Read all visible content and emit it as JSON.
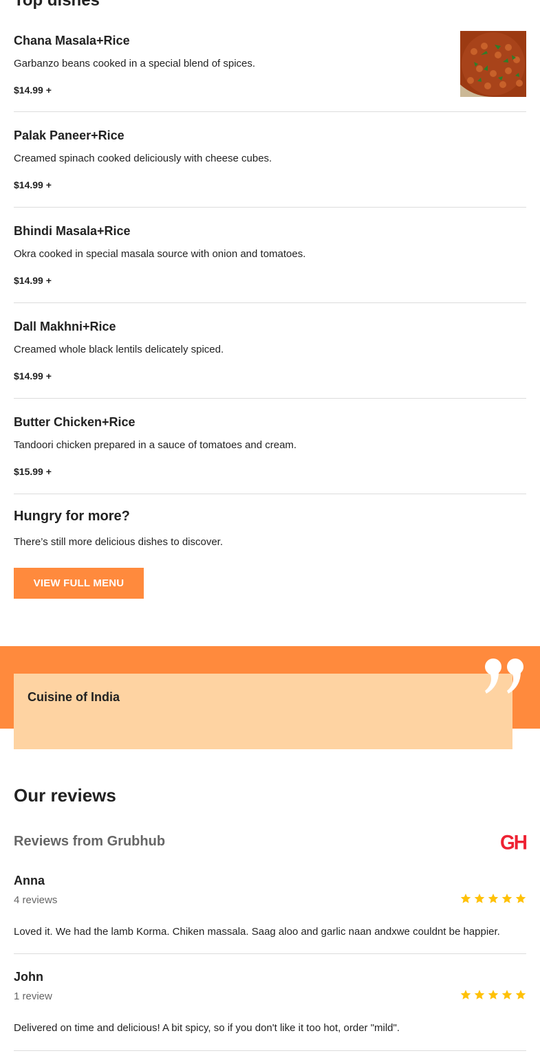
{
  "top_dishes": {
    "title": "Top dishes",
    "items": [
      {
        "name": "Chana Masala+Rice",
        "description": "Garbanzo beans cooked in a special blend of spices.",
        "price": "$14.99 +"
      },
      {
        "name": "Palak Paneer+Rice",
        "description": "Creamed spinach cooked deliciously with cheese cubes.",
        "price": "$14.99 +"
      },
      {
        "name": "Bhindi Masala+Rice",
        "description": "Okra cooked in special masala source with onion and tomatoes.",
        "price": "$14.99 +"
      },
      {
        "name": "Dall Makhni+Rice",
        "description": "Creamed whole black lentils delicately spiced.",
        "price": "$14.99 +"
      },
      {
        "name": "Butter Chicken+Rice",
        "description": "Tandoori chicken prepared in a sauce of tomatoes and cream.",
        "price": "$15.99 +"
      }
    ]
  },
  "more": {
    "title": "Hungry for more?",
    "text": "There’s still more delicious dishes to discover.",
    "button_label": "VIEW FULL MENU"
  },
  "testimonial": {
    "name": "Cuisine of India"
  },
  "reviews": {
    "title": "Our reviews",
    "source_label": "Reviews from Grubhub",
    "source_logo": "GH",
    "items": [
      {
        "name": "Anna",
        "count": "4 reviews",
        "rating": 5,
        "text": "Loved it. We had the lamb Korma. Chiken massala. Saag aloo and garlic naan andxwe couldnt be happier."
      },
      {
        "name": "John",
        "count": "1 review",
        "rating": 5,
        "text": "Delivered on time and delicious! A bit spicy, so if you don't like it too hot, order \"mild\"."
      }
    ]
  },
  "colors": {
    "accent": "#ff8a3d",
    "card": "#fed3a2",
    "star": "#ffc107",
    "grubhub": "#ee2233"
  }
}
